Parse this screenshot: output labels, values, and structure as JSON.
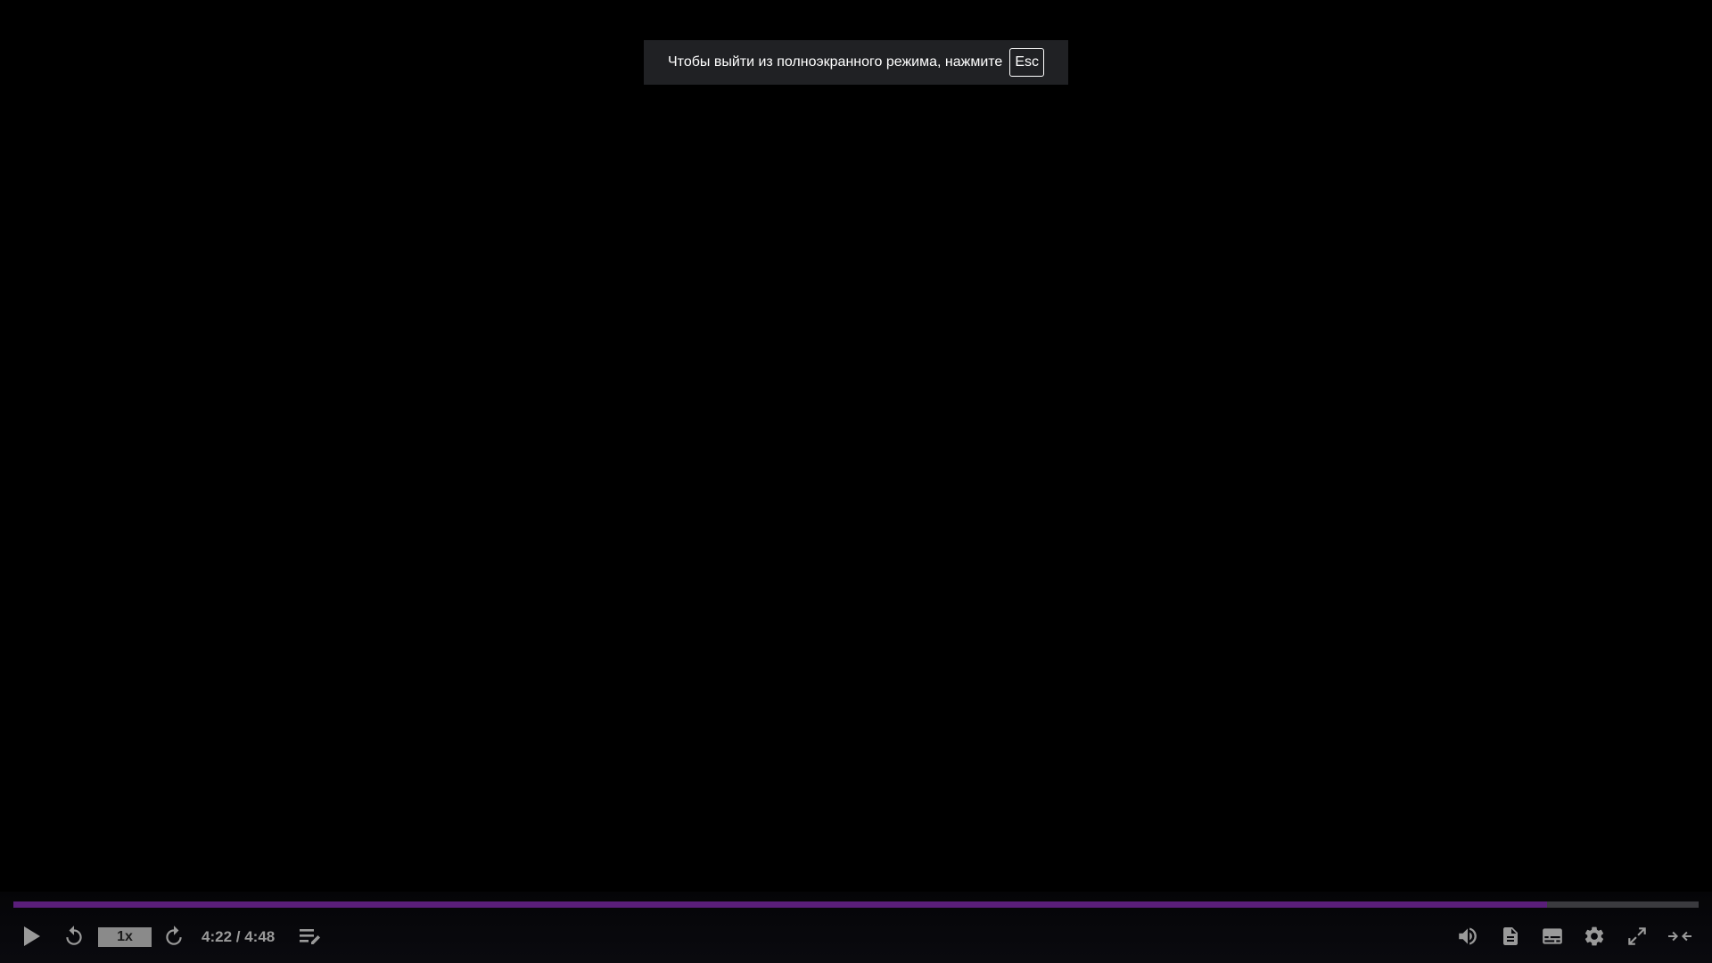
{
  "notice": {
    "text": "Чтобы выйти из полноэкранного режима, нажмите",
    "key": "Esc"
  },
  "player": {
    "progress_fraction": 0.91,
    "speed_label": "1x",
    "current_time": "4:22",
    "duration": "4:48",
    "time_separator": " / ",
    "accent_color": "#5a1e7a"
  },
  "icons": {
    "play": "play-icon",
    "rewind": "replay-icon",
    "forward": "forward-icon",
    "notes": "edit-notes-icon",
    "volume": "volume-icon",
    "transcript": "document-icon",
    "subtitles": "subtitles-icon",
    "settings": "gear-icon",
    "fullscreen": "expand-icon",
    "exit": "collapse-icon"
  }
}
